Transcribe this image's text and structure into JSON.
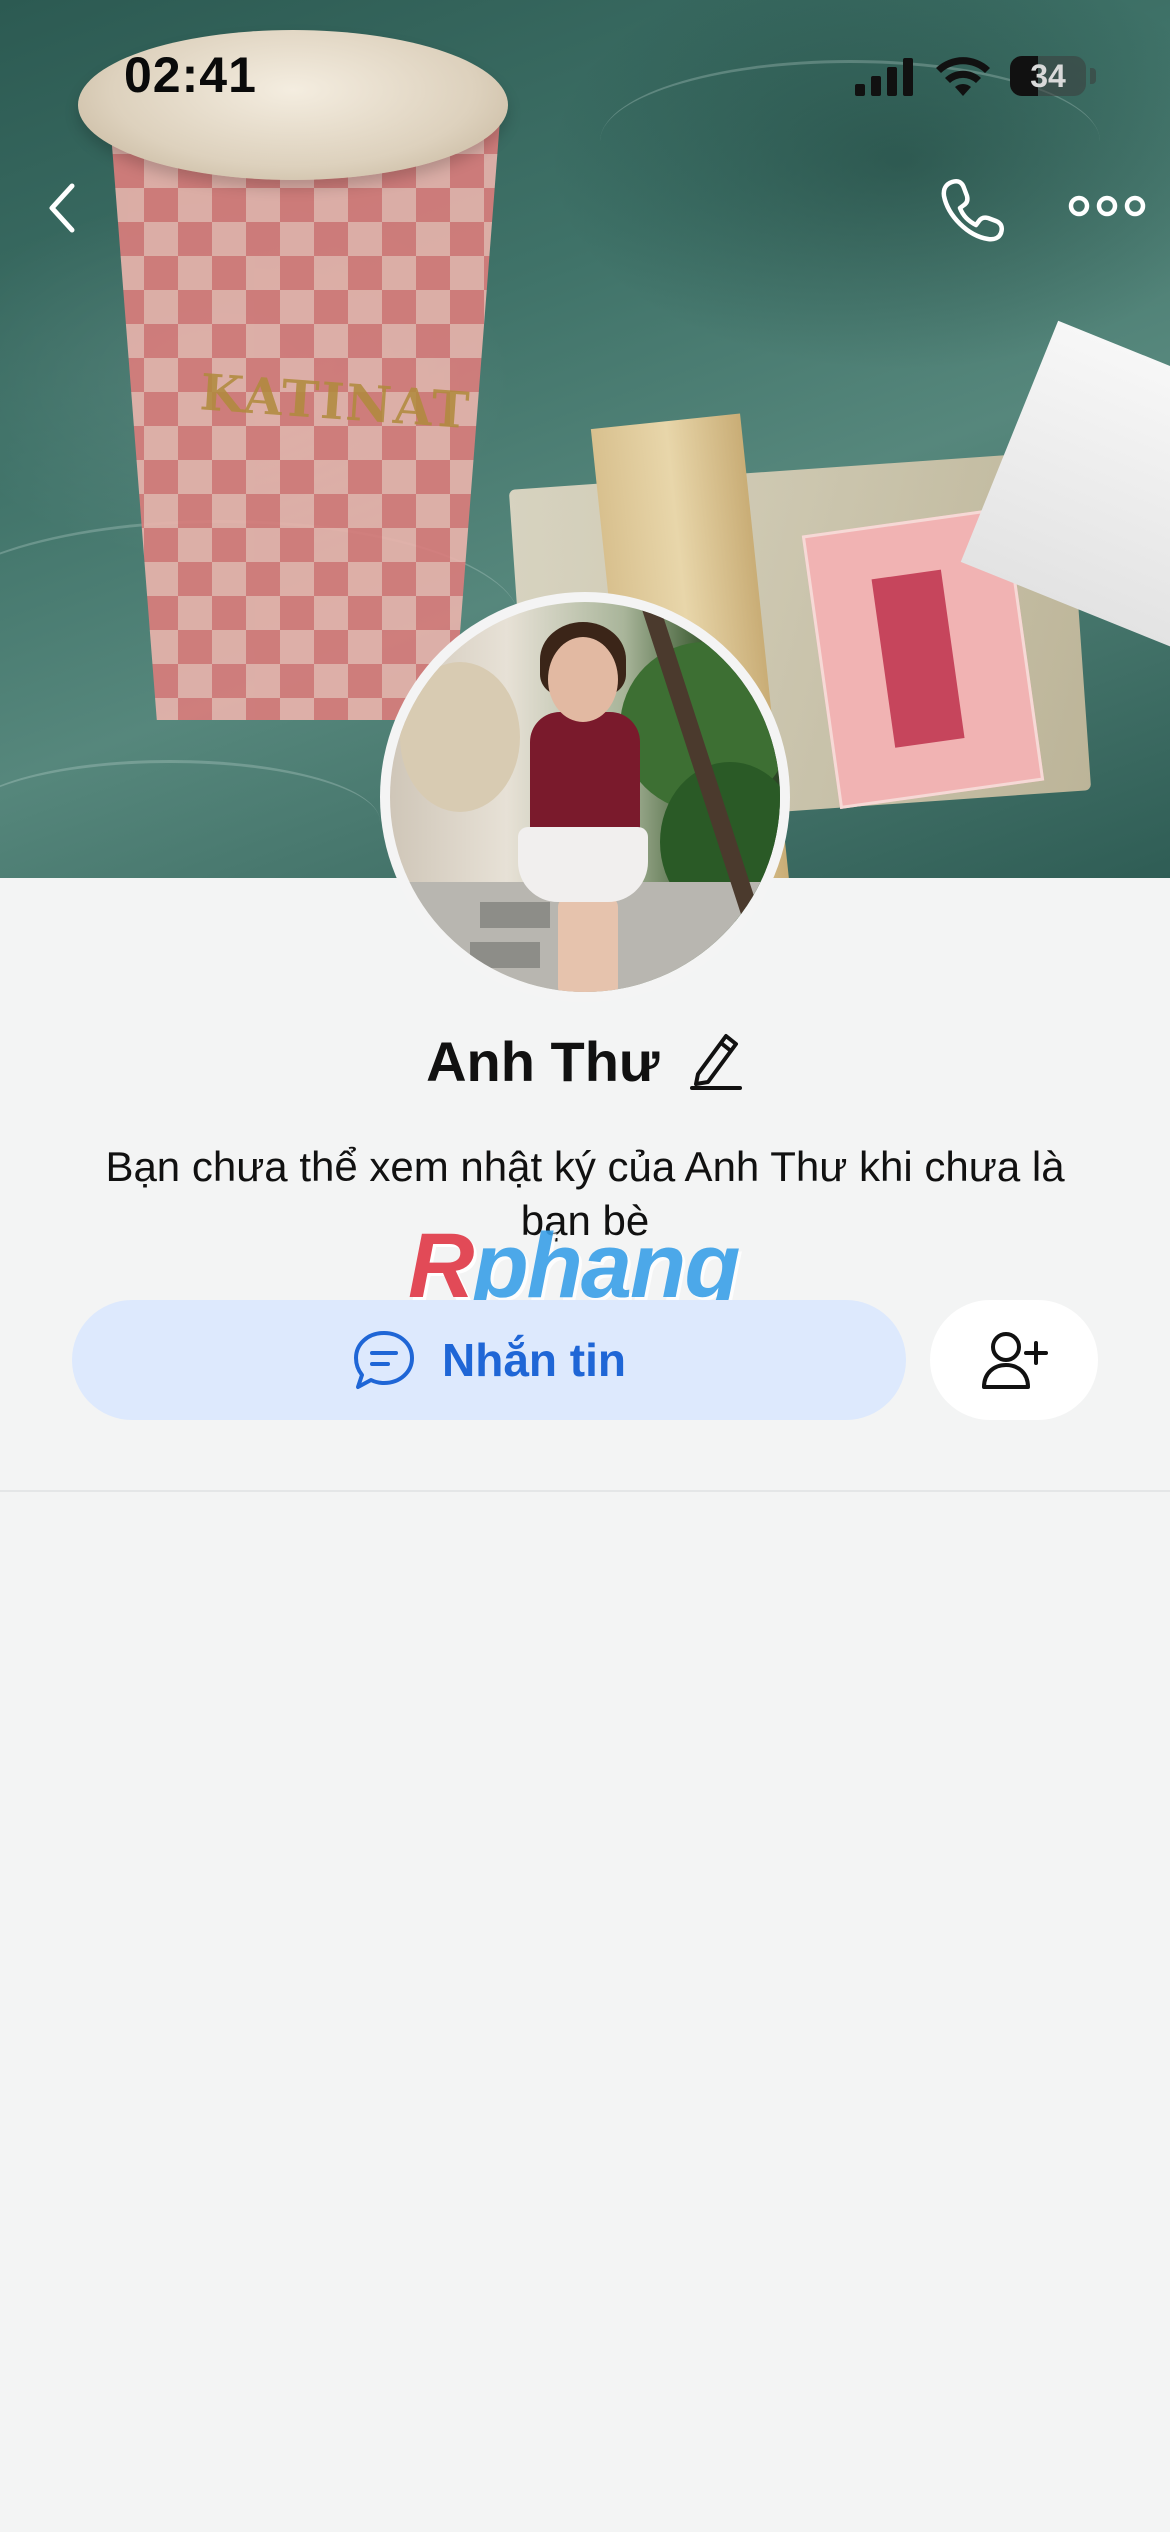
{
  "status_bar": {
    "time": "02:41",
    "battery": "34"
  },
  "cover": {
    "brand_text": "KATINAT"
  },
  "profile": {
    "name": "Anh Thư",
    "privacy_note": "Bạn chưa thể xem nhật ký của Anh Thư khi chưa là bạn bè"
  },
  "actions": {
    "message_label": "Nhắn tin"
  },
  "watermark": {
    "part1": "R",
    "part2": "phang"
  },
  "icons": {
    "back": "chevron-left-icon",
    "call": "phone-icon",
    "more": "more-horizontal-icon",
    "edit": "pencil-icon",
    "message": "chat-bubble-icon",
    "add_friend": "user-plus-icon"
  },
  "colors": {
    "accent": "#1f66d6",
    "message_button_bg": "#dde9fd",
    "page_bg": "#f3f4f4"
  }
}
